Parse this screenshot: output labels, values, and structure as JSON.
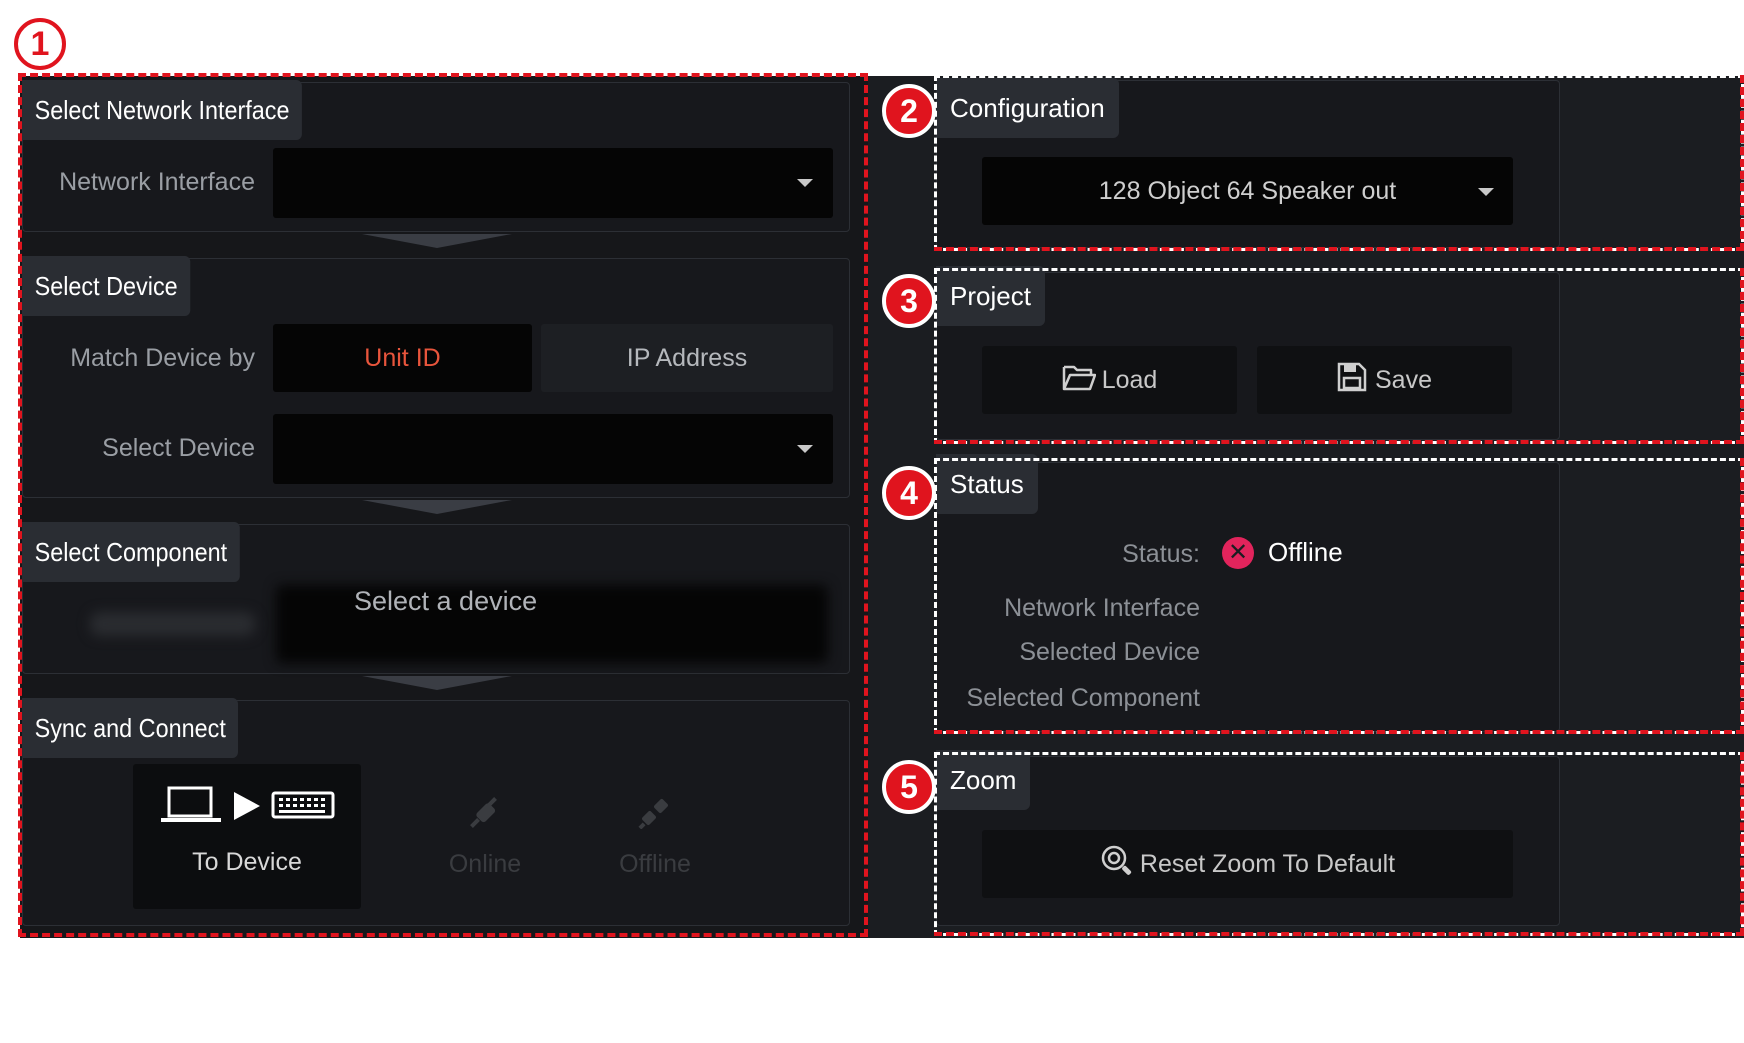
{
  "badges": [
    "1",
    "2",
    "3",
    "4",
    "5"
  ],
  "left": {
    "network": {
      "tab": "Select Network Interface",
      "label": "Network Interface",
      "value": ""
    },
    "device": {
      "tab": "Select Device",
      "match_label": "Match Device by",
      "match_options": [
        "Unit ID",
        "IP Address"
      ],
      "selected_match": "Unit ID",
      "select_label": "Select Device",
      "select_value": ""
    },
    "component": {
      "tab": "Select Component",
      "placeholder": "Select a device"
    },
    "sync": {
      "tab": "Sync and Connect",
      "to_device": "To Device",
      "online": "Online",
      "offline": "Offline"
    }
  },
  "right": {
    "configuration": {
      "tab": "Configuration",
      "value": "128 Object 64 Speaker out"
    },
    "project": {
      "tab": "Project",
      "load": "Load",
      "save": "Save"
    },
    "status": {
      "tab": "Status",
      "status_label": "Status:",
      "status_value": "Offline",
      "rows": [
        "Network Interface",
        "Selected Device",
        "Selected Component"
      ]
    },
    "zoom": {
      "tab": "Zoom",
      "reset": "Reset Zoom To Default"
    }
  },
  "colors": {
    "accent_selected": "#e8553c",
    "offline_icon": "#e2245c",
    "annotation_red": "#e0141e"
  }
}
